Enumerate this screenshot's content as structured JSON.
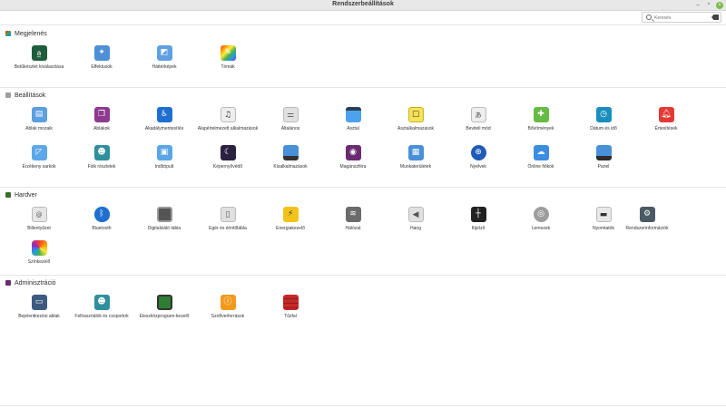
{
  "window": {
    "title": "Rendszerbeállítások"
  },
  "search": {
    "placeholder": "Keresés"
  },
  "sections": {
    "appearance": {
      "title": "Megjelenés"
    },
    "preferences": {
      "title": "Beállítások"
    },
    "hardware": {
      "title": "Hardver"
    },
    "admin": {
      "title": "Adminisztráció"
    }
  },
  "items": {
    "fonts": {
      "label": "Betűkészlet kiválasztása",
      "icon": "font-icon"
    },
    "effects": {
      "label": "Effektusok",
      "icon": "effects-icon"
    },
    "backgrounds": {
      "label": "Háttérképek",
      "icon": "wallpaper-icon"
    },
    "themes": {
      "label": "Témák",
      "icon": "themes-icon"
    },
    "window_tiling": {
      "label": "Ablak mozaik",
      "icon": "window-tiling-icon"
    },
    "windows": {
      "label": "Ablakok",
      "icon": "windows-icon"
    },
    "accessibility": {
      "label": "Akadálymentesítés",
      "icon": "accessibility-icon"
    },
    "default_apps": {
      "label": "Alapértelmezett alkalmazások",
      "icon": "default-apps-icon"
    },
    "general": {
      "label": "Általános",
      "icon": "general-icon"
    },
    "desktop": {
      "label": "Asztal",
      "icon": "desktop-icon"
    },
    "desklets": {
      "label": "Asztalkalmazások",
      "icon": "desklets-icon"
    },
    "input_method": {
      "label": "Beviteli mód",
      "icon": "input-method-icon"
    },
    "extensions": {
      "label": "Bővítmények",
      "icon": "extensions-icon"
    },
    "date_time": {
      "label": "Dátum és idő",
      "icon": "clock-icon"
    },
    "notifications": {
      "label": "Értesítések",
      "icon": "bell-icon"
    },
    "hot_corners": {
      "label": "Érzékeny sarkok",
      "icon": "hot-corners-icon"
    },
    "account": {
      "label": "Fiók részletek",
      "icon": "account-icon"
    },
    "startup": {
      "label": "Indítópult",
      "icon": "startup-icon"
    },
    "screensaver": {
      "label": "Képernyővédő",
      "icon": "screensaver-icon"
    },
    "applets": {
      "label": "Kisalkalmazások",
      "icon": "applets-icon"
    },
    "privacy": {
      "label": "Magánszféra",
      "icon": "privacy-icon"
    },
    "workspaces": {
      "label": "Munkaterületek",
      "icon": "workspaces-icon"
    },
    "languages": {
      "label": "Nyelvek",
      "icon": "languages-icon"
    },
    "online_accounts": {
      "label": "Online fiókok",
      "icon": "cloud-icon"
    },
    "panel": {
      "label": "Panel",
      "icon": "panel-icon"
    },
    "keyboard": {
      "label": "Billentyűzet",
      "icon": "keyboard-icon"
    },
    "bluetooth": {
      "label": "Bluetooth",
      "icon": "bluetooth-icon"
    },
    "tablet": {
      "label": "Digitalizáló tábla",
      "icon": "tablet-icon"
    },
    "mouse": {
      "label": "Egér és érintőlábla",
      "icon": "mouse-icon"
    },
    "power": {
      "label": "Energiakezelő",
      "icon": "power-icon"
    },
    "network": {
      "label": "Hálózat",
      "icon": "network-icon"
    },
    "sound": {
      "label": "Hang",
      "icon": "sound-icon"
    },
    "display": {
      "label": "Kijelző",
      "icon": "display-icon"
    },
    "disks": {
      "label": "Lemezek",
      "icon": "disks-icon"
    },
    "printers": {
      "label": "Nyomtatók",
      "icon": "printer-icon"
    },
    "system_info": {
      "label": "Rendszerinformációk",
      "icon": "gear-icon"
    },
    "color": {
      "label": "Színkezelő",
      "icon": "color-icon"
    },
    "login_window": {
      "label": "Bejelentkezési ablak",
      "icon": "login-window-icon"
    },
    "users_groups": {
      "label": "Felhasználók és csoportok",
      "icon": "users-icon"
    },
    "drivers": {
      "label": "Eleszközprogram-kezelő",
      "icon": "driver-chip-icon"
    },
    "software_sources": {
      "label": "Szoftverforrások",
      "icon": "info-icon"
    },
    "firewall": {
      "label": "Tűzfal",
      "icon": "firewall-icon"
    }
  }
}
